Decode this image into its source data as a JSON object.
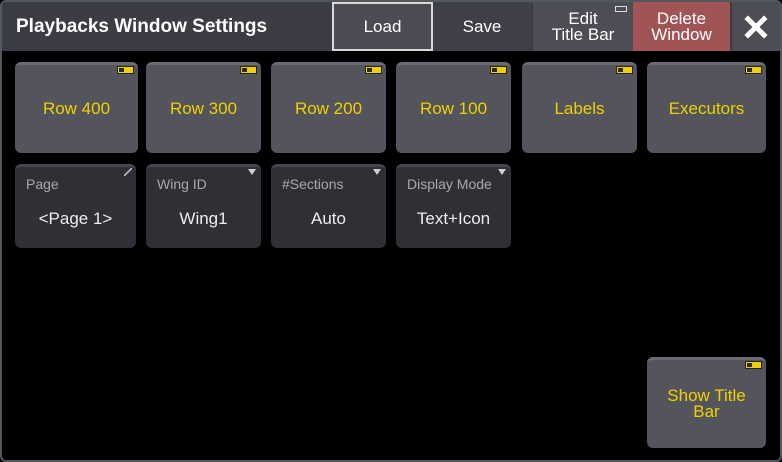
{
  "window": {
    "title": "Playbacks Window Settings",
    "buttons": {
      "load": "Load",
      "save": "Save",
      "edit_title_bar_line1": "Edit",
      "edit_title_bar_line2": "Title Bar",
      "delete_window_line1": "Delete",
      "delete_window_line2": "Window",
      "close_icon": "close-icon"
    }
  },
  "toggle_buttons": [
    {
      "label": "Row 400"
    },
    {
      "label": "Row 300"
    },
    {
      "label": "Row 200"
    },
    {
      "label": "Row 100"
    },
    {
      "label": "Labels"
    },
    {
      "label": "Executors"
    }
  ],
  "fields": [
    {
      "label": "Page",
      "value": "<Page 1>"
    },
    {
      "label": "Wing ID",
      "value": "Wing1"
    },
    {
      "label": "#Sections",
      "value": "Auto"
    },
    {
      "label": "Display Mode",
      "value": "Text+Icon"
    }
  ],
  "show_title_bar": {
    "line1": "Show Title",
    "line2": "Bar"
  },
  "colors": {
    "accent_text": "#f0d000",
    "delete_button": "#a05455",
    "titlebar": "#3c3d44"
  }
}
